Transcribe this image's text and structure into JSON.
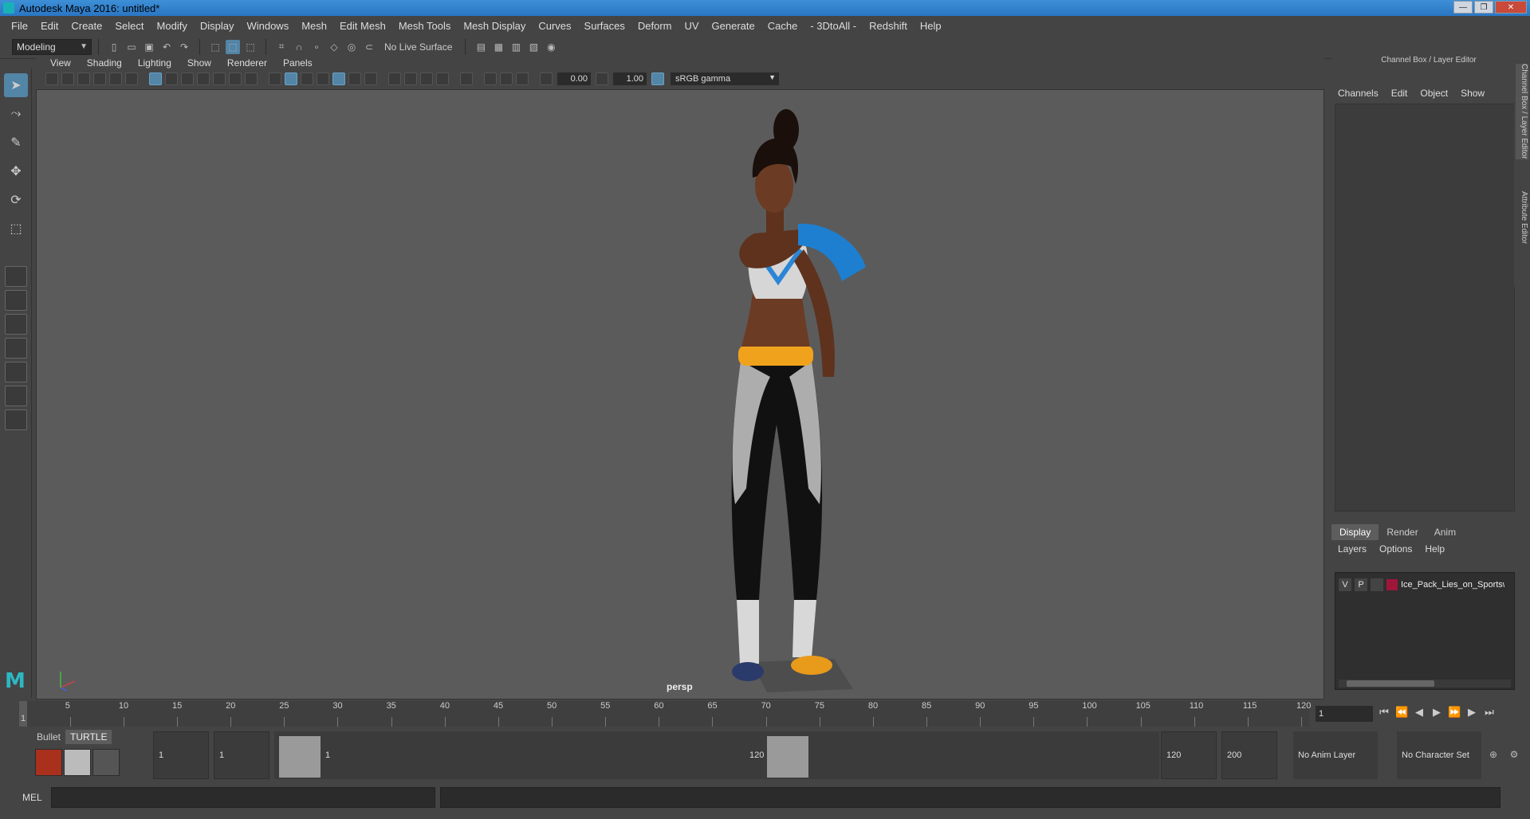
{
  "window": {
    "title": "Autodesk Maya 2016: untitled*"
  },
  "menu": [
    "File",
    "Edit",
    "Create",
    "Select",
    "Modify",
    "Display",
    "Windows",
    "Mesh",
    "Edit Mesh",
    "Mesh Tools",
    "Mesh Display",
    "Curves",
    "Surfaces",
    "Deform",
    "UV",
    "Generate",
    "Cache",
    "- 3DtoAll -",
    "Redshift",
    "Help"
  ],
  "statusline": {
    "mode": "Modeling",
    "live_surface": "No Live Surface"
  },
  "panel": {
    "menu": [
      "View",
      "Shading",
      "Lighting",
      "Show",
      "Renderer",
      "Panels"
    ],
    "exposure": "0.00",
    "gamma": "1.00",
    "color_space": "sRGB gamma",
    "camera": "persp"
  },
  "channel_box": {
    "title": "Channel Box / Layer Editor",
    "menu": [
      "Channels",
      "Edit",
      "Object",
      "Show"
    ],
    "side_tabs": [
      "Channel Box / Layer Editor",
      "Attribute Editor"
    ]
  },
  "layer_editor": {
    "tabs": [
      "Display",
      "Render",
      "Anim"
    ],
    "menu": [
      "Layers",
      "Options",
      "Help"
    ],
    "layer": {
      "v": "V",
      "p": "P",
      "name": "Ice_Pack_Lies_on_Sportswoman",
      "color": "#a0163a"
    }
  },
  "timeline": {
    "ticks": [
      "5",
      "10",
      "15",
      "20",
      "25",
      "30",
      "35",
      "40",
      "45",
      "50",
      "55",
      "60",
      "65",
      "70",
      "75",
      "80",
      "85",
      "90",
      "95",
      "100",
      "105",
      "110",
      "115",
      "120"
    ],
    "start_label": "1",
    "current_frame": "1"
  },
  "range": {
    "shelf_tabs": [
      "Bullet",
      "TURTLE"
    ],
    "start": "1",
    "anim_start": "1",
    "range_start_label": "1",
    "range_end_label": "120",
    "anim_end": "120",
    "end": "200",
    "anim_layer": "No Anim Layer",
    "character_set": "No Character Set"
  },
  "cmdline": {
    "label": "MEL"
  }
}
